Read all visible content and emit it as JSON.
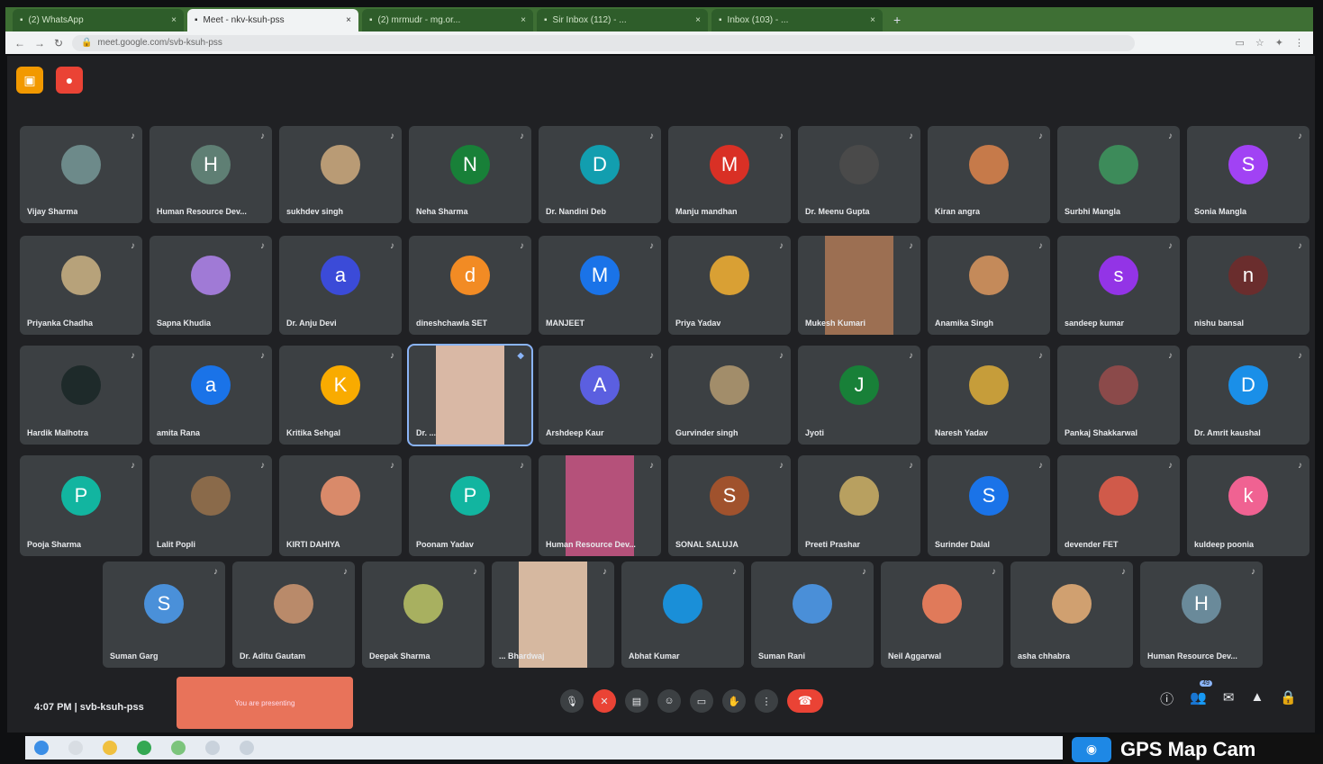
{
  "browser": {
    "tabs": [
      {
        "label": "(2) WhatsApp",
        "active": false
      },
      {
        "label": "Meet - nkv-ksuh-pss",
        "active": true
      },
      {
        "label": "(2) mrmudr - mg.or...",
        "active": false
      },
      {
        "label": "Sir Inbox (112) - ...",
        "active": false
      },
      {
        "label": "Inbox (103) - ...",
        "active": false
      }
    ],
    "new_tab": "+",
    "url": "meet.google.com/svb-ksuh-pss"
  },
  "meet": {
    "top_icons": [
      {
        "name": "people-icon",
        "glyph": "▣",
        "color": "#f29900"
      },
      {
        "name": "record-icon",
        "glyph": "●",
        "color": "#ea4335"
      }
    ],
    "participants_rows": [
      [
        {
          "name": "Vijay Sharma",
          "avatar": "photo",
          "color": "#6d8a8a"
        },
        {
          "name": "Human Resource Dev...",
          "avatar": "H",
          "color": "#5f7f74"
        },
        {
          "name": "sukhdev singh",
          "avatar": "photo",
          "color": "#b99b75"
        },
        {
          "name": "Neha Sharma",
          "avatar": "N",
          "color": "#188038"
        },
        {
          "name": "Dr. Nandini Deb",
          "avatar": "D",
          "color": "#129eaf"
        },
        {
          "name": "Manju mandhan",
          "avatar": "M",
          "color": "#d93025"
        },
        {
          "name": "Dr. Meenu Gupta",
          "avatar": "photo",
          "color": "#4a4a4a"
        },
        {
          "name": "Kiran angra",
          "avatar": "photo",
          "color": "#c67a4a"
        },
        {
          "name": "Surbhi Mangla",
          "avatar": "photo",
          "color": "#3d8b5a"
        },
        {
          "name": "Sonia Mangla",
          "avatar": "S",
          "color": "#a142f4"
        }
      ],
      [
        {
          "name": "Priyanka Chadha",
          "avatar": "photo",
          "color": "#b7a27a"
        },
        {
          "name": "Sapna Khudia",
          "avatar": "photo",
          "color": "#a07ad6"
        },
        {
          "name": "Dr. Anju Devi",
          "avatar": "a",
          "color": "#3b4bd8"
        },
        {
          "name": "dineshchawla SET",
          "avatar": "d",
          "color": "#f28b24"
        },
        {
          "name": "MANJEET",
          "avatar": "M",
          "color": "#1a73e8"
        },
        {
          "name": "Priya Yadav",
          "avatar": "photo",
          "color": "#d9a034"
        },
        {
          "name": "Mukesh Kumari",
          "avatar": "video",
          "color": "#9c6f52"
        },
        {
          "name": "Anamika Singh",
          "avatar": "photo",
          "color": "#c48a5a"
        },
        {
          "name": "sandeep kumar",
          "avatar": "s",
          "color": "#9334e6"
        },
        {
          "name": "nishu bansal",
          "avatar": "n",
          "color": "#6a2d2d"
        }
      ],
      [
        {
          "name": "Hardik Malhotra",
          "avatar": "photo",
          "color": "#1e2a2a"
        },
        {
          "name": "amita Rana",
          "avatar": "a",
          "color": "#1a73e8"
        },
        {
          "name": "Kritika Sehgal",
          "avatar": "K",
          "color": "#f9ab00"
        },
        {
          "name": "Dr. ...",
          "avatar": "video",
          "color": "#d9b8a5",
          "speaking": true
        },
        {
          "name": "Arshdeep Kaur",
          "avatar": "A",
          "color": "#5b5fe0"
        },
        {
          "name": "Gurvinder singh",
          "avatar": "photo",
          "color": "#a28d6a"
        },
        {
          "name": "Jyoti",
          "avatar": "J",
          "color": "#188038"
        },
        {
          "name": "Naresh Yadav",
          "avatar": "photo",
          "color": "#c69d3a"
        },
        {
          "name": "Pankaj Shakkarwal",
          "avatar": "photo",
          "color": "#8b4a4a"
        },
        {
          "name": "Dr. Amrit kaushal",
          "avatar": "D",
          "color": "#1a8fe8"
        }
      ],
      [
        {
          "name": "Pooja Sharma",
          "avatar": "P",
          "color": "#12b5a0"
        },
        {
          "name": "Lalit Popli",
          "avatar": "photo",
          "color": "#8a6a4a"
        },
        {
          "name": "KIRTI DAHIYA",
          "avatar": "photo",
          "color": "#d98a6a"
        },
        {
          "name": "Poonam Yadav",
          "avatar": "P",
          "color": "#12b5a0"
        },
        {
          "name": "Human Resource Dev...",
          "avatar": "video",
          "color": "#b5517a"
        },
        {
          "name": "SONAL SALUJA",
          "avatar": "S",
          "color": "#a0522d"
        },
        {
          "name": "Preeti Prashar",
          "avatar": "photo",
          "color": "#b8a060"
        },
        {
          "name": "Surinder Dalal",
          "avatar": "S",
          "color": "#1a73e8"
        },
        {
          "name": "devender FET",
          "avatar": "photo",
          "color": "#d05a4a"
        },
        {
          "name": "kuldeep poonia",
          "avatar": "k",
          "color": "#f06292"
        }
      ],
      [
        {
          "name": "Suman Garg",
          "avatar": "S",
          "color": "#4a90d9"
        },
        {
          "name": "Dr. Aditu Gautam",
          "avatar": "photo",
          "color": "#b98a6a"
        },
        {
          "name": "Deepak Sharma",
          "avatar": "photo",
          "color": "#a8b060"
        },
        {
          "name": "... Bhardwaj",
          "avatar": "video",
          "color": "#d6b8a0"
        },
        {
          "name": "Abhat Kumar",
          "avatar": "photo",
          "color": "#1a8fd8"
        },
        {
          "name": "Suman Rani",
          "avatar": "photo",
          "color": "#4a8fd8"
        },
        {
          "name": "Neil Aggarwal",
          "avatar": "photo",
          "color": "#e07a5a"
        },
        {
          "name": "asha chhabra",
          "avatar": "photo",
          "color": "#d0a070"
        },
        {
          "name": "Human Resource Dev...",
          "avatar": "H",
          "color": "#6a8a9a"
        }
      ]
    ],
    "bottom": {
      "time": "4:07 PM",
      "separator": "|",
      "meeting_code": "svb-ksuh-pss",
      "presenting_label": "You are presenting",
      "controls": [
        {
          "name": "mic-icon",
          "glyph": "🎙",
          "red": false
        },
        {
          "name": "camera-off-icon",
          "glyph": "✕",
          "red": true
        },
        {
          "name": "captions-icon",
          "glyph": "▤",
          "red": false
        },
        {
          "name": "emoji-icon",
          "glyph": "☺",
          "red": false
        },
        {
          "name": "present-icon",
          "glyph": "▭",
          "red": false
        },
        {
          "name": "raise-hand-icon",
          "glyph": "✋",
          "red": false
        },
        {
          "name": "more-options-icon",
          "glyph": "⋮",
          "red": false
        }
      ],
      "end_call_glyph": "☎",
      "side": [
        {
          "name": "info-icon",
          "glyph": "ⓘ"
        },
        {
          "name": "people-icon",
          "glyph": "👥",
          "badge": "49"
        },
        {
          "name": "chat-icon",
          "glyph": "✉"
        },
        {
          "name": "activities-icon",
          "glyph": "▲"
        },
        {
          "name": "lock-icon",
          "glyph": "🔒"
        }
      ]
    }
  },
  "watermark": {
    "text": "GPS Map Cam"
  }
}
